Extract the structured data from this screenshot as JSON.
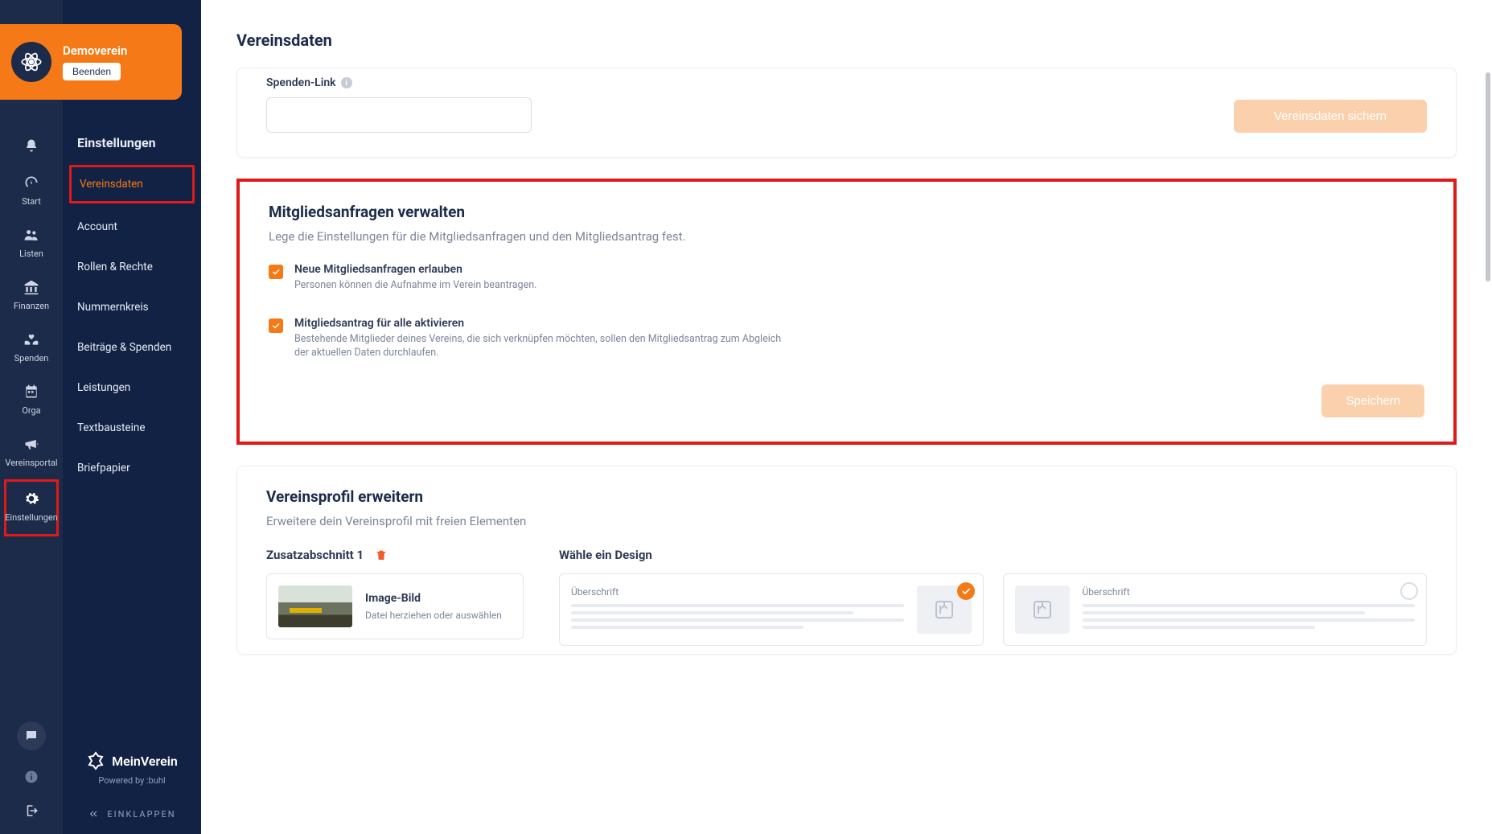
{
  "org": {
    "name": "Demoverein",
    "exit_label": "Beenden"
  },
  "rail": {
    "items": [
      {
        "key": "bell",
        "label": ""
      },
      {
        "key": "start",
        "label": "Start"
      },
      {
        "key": "listen",
        "label": "Listen"
      },
      {
        "key": "finanzen",
        "label": "Finanzen"
      },
      {
        "key": "spenden",
        "label": "Spenden"
      },
      {
        "key": "orga",
        "label": "Orga"
      },
      {
        "key": "vereinsportal",
        "label": "Vereinsportal"
      },
      {
        "key": "einstellungen",
        "label": "Einstellungen"
      }
    ]
  },
  "sidebar": {
    "heading": "Einstellungen",
    "items": [
      "Vereinsdaten",
      "Account",
      "Rollen & Rechte",
      "Nummernkreis",
      "Beiträge & Spenden",
      "Leistungen",
      "Textbausteine",
      "Briefpapier"
    ],
    "brand": "MeinVerein",
    "powered": "Powered by :buhl",
    "collapse": "EINKLAPPEN"
  },
  "page": {
    "title": "Vereinsdaten",
    "spenden_link_label": "Spenden-Link",
    "save_vereinsdaten": "Vereinsdaten sichern",
    "mitglied": {
      "title": "Mitgliedsanfragen verwalten",
      "subtitle": "Lege die Einstellungen für die Mitgliedsanfragen und den Mitgliedsantrag fest.",
      "opt1_title": "Neue Mitgliedsanfragen erlauben",
      "opt1_sub": "Personen können die Aufnahme im Verein beantragen.",
      "opt2_title": "Mitgliedsantrag für alle aktivieren",
      "opt2_sub": "Bestehende Mitglieder deines Vereins, die sich verknüpfen möchten, sollen den Mitgliedsantrag zum Abgleich der aktuellen Daten durchlaufen.",
      "save": "Speichern"
    },
    "profil": {
      "title": "Vereinsprofil erweitern",
      "subtitle": "Erweitere dein Vereinsprofil mit freien Elementen",
      "zusatz_label": "Zusatzabschnitt 1",
      "image_label": "Image-Bild",
      "image_hint": "Datei herziehen oder auswählen",
      "design_title": "Wähle ein Design",
      "design_heading": "Überschrift"
    }
  }
}
